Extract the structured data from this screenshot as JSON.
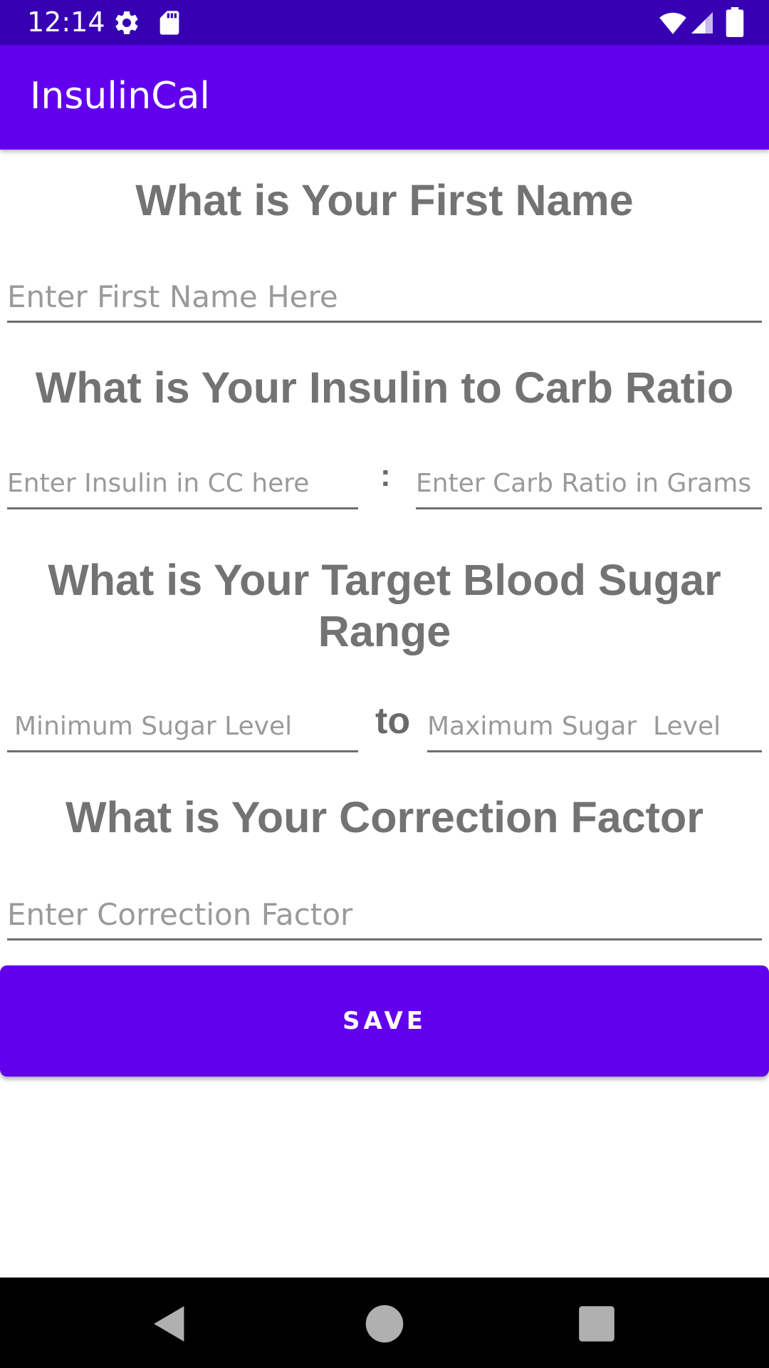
{
  "status_bar": {
    "time": "12:14",
    "icons": [
      "settings-icon",
      "sd-card-icon",
      "wifi-icon",
      "signal-icon",
      "battery-icon"
    ]
  },
  "app_bar": {
    "title": "InsulinCal"
  },
  "sections": {
    "first_name": {
      "heading": "What is Your First Name",
      "placeholder": "Enter First Name Here"
    },
    "ratio": {
      "heading": "What is Your Insulin to Carb Ratio",
      "insulin_placeholder": "Enter Insulin in CC here",
      "separator": ":",
      "carb_placeholder": "Enter Carb Ratio in Grams"
    },
    "range": {
      "heading": "What is Your Target Blood Sugar Range",
      "min_placeholder": "Minimum Sugar Level",
      "separator": "to",
      "max_placeholder": "Maximum Sugar  Level"
    },
    "correction": {
      "heading": "What is Your Correction Factor",
      "placeholder": "Enter Correction Factor"
    }
  },
  "save_button": {
    "label": "SAVE"
  },
  "nav_bar": {
    "icons": [
      "back-icon",
      "home-icon",
      "recents-icon"
    ]
  },
  "colors": {
    "status_bar": "#3700b3",
    "primary": "#6200ee",
    "heading_text": "#737373",
    "underline": "#6e6e6e",
    "placeholder": "#9a9a9a"
  }
}
